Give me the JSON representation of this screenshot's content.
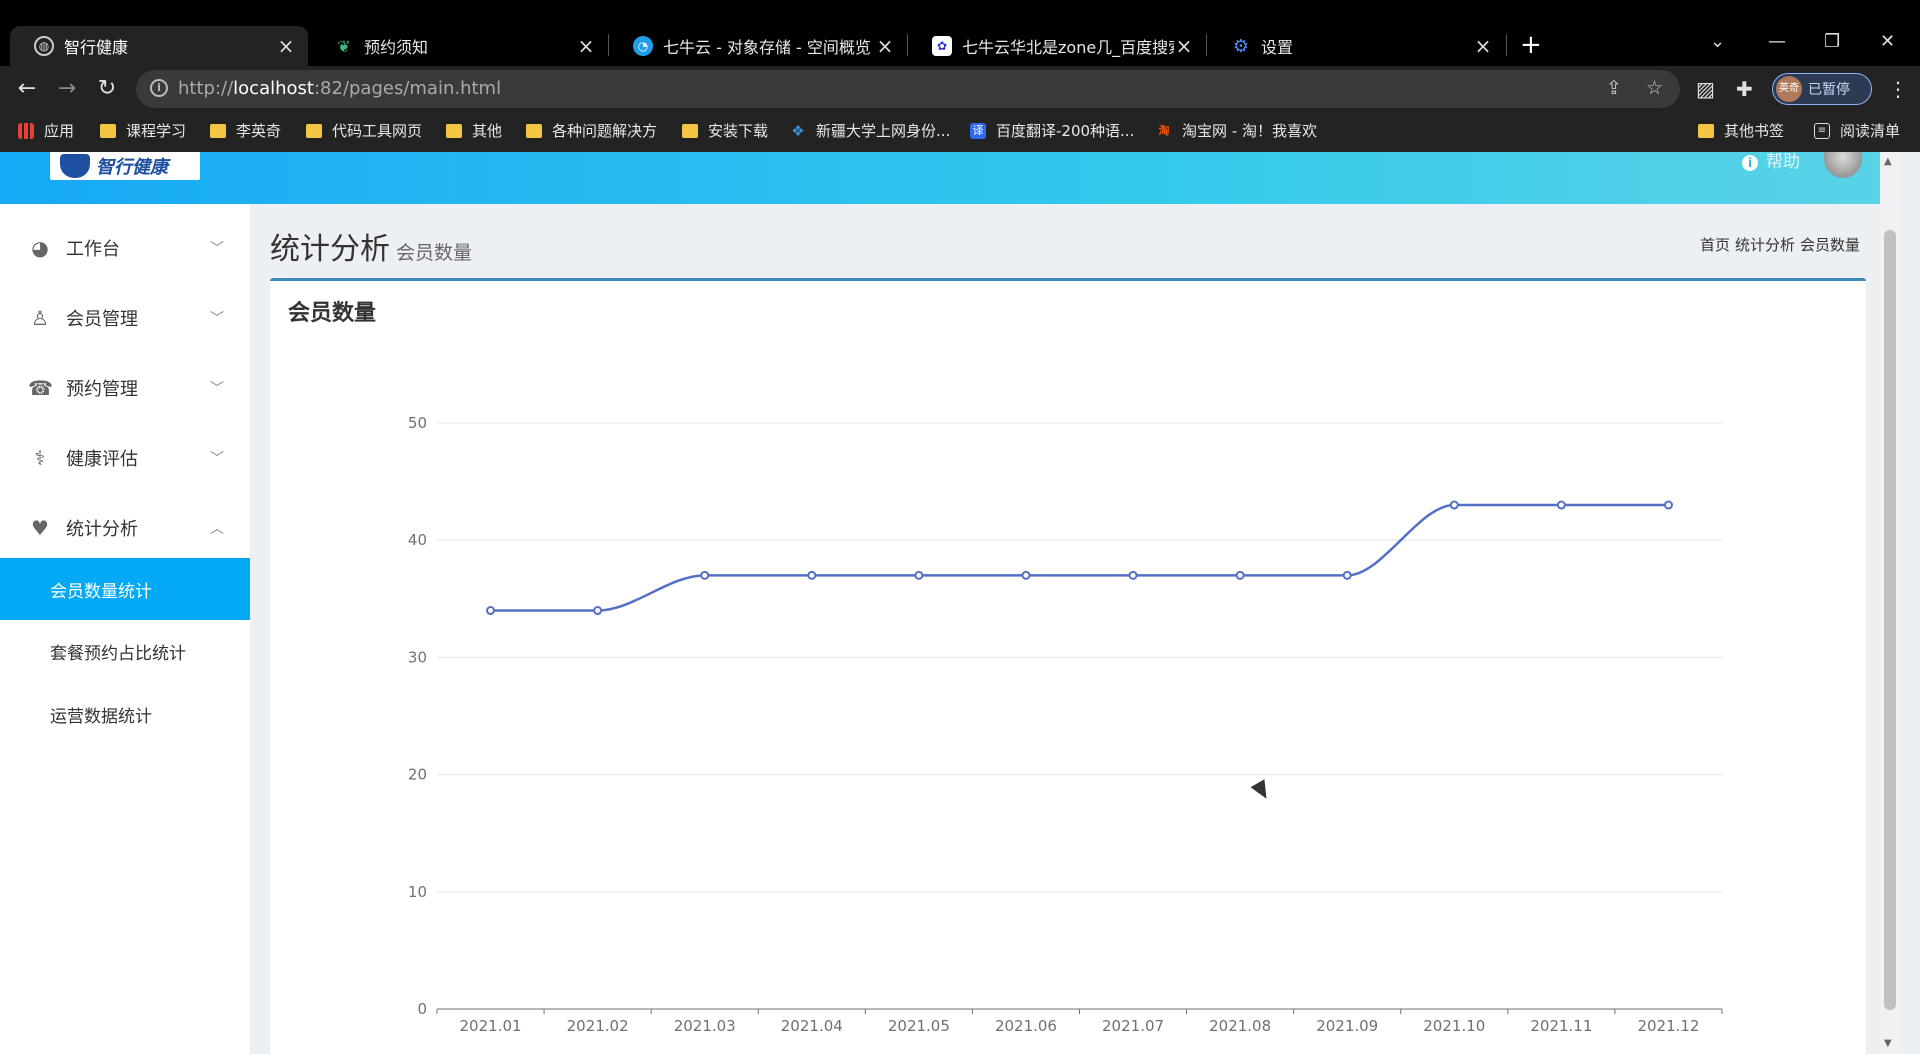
{
  "browser": {
    "tabs": [
      {
        "title": "智行健康",
        "icon": "globe-icon",
        "active": true
      },
      {
        "title": "预约须知",
        "icon": "vue-icon"
      },
      {
        "title": "七牛云 - 对象存储 - 空间概览",
        "icon": "qiniu-icon"
      },
      {
        "title": "七牛云华北是zone几_百度搜索",
        "icon": "baidu-icon"
      },
      {
        "title": "设置",
        "icon": "gear-icon"
      }
    ],
    "url_prefix": "http://",
    "url_host": "localhost",
    "url_rest": ":82/pages/main.html",
    "profile_label": "已暂停",
    "profile_avatar_text": "英奇",
    "bookmarks": [
      {
        "label": "应用",
        "type": "apps"
      },
      {
        "label": "课程学习",
        "type": "folder"
      },
      {
        "label": "李英奇",
        "type": "folder"
      },
      {
        "label": "代码工具网页",
        "type": "folder"
      },
      {
        "label": "其他",
        "type": "folder"
      },
      {
        "label": "各种问题解决方",
        "type": "folder"
      },
      {
        "label": "安装下载",
        "type": "folder"
      },
      {
        "label": "新疆大学上网身份...",
        "type": "site"
      },
      {
        "label": "百度翻译-200种语...",
        "type": "site",
        "glyph": "译"
      },
      {
        "label": "淘宝网 - 淘！我喜欢",
        "type": "site",
        "glyph": "淘"
      },
      {
        "label": "其他书签",
        "type": "folder"
      },
      {
        "label": "阅读清单",
        "type": "list"
      }
    ]
  },
  "header": {
    "logo_text": "智行健康",
    "help_label": "帮助"
  },
  "sidebar": {
    "groups": [
      {
        "label": "工作台",
        "icon": "dashboard-icon",
        "expanded": false
      },
      {
        "label": "会员管理",
        "icon": "user-icon",
        "expanded": false
      },
      {
        "label": "预约管理",
        "icon": "phone-icon",
        "expanded": false
      },
      {
        "label": "健康评估",
        "icon": "stethoscope-icon",
        "expanded": false
      },
      {
        "label": "统计分析",
        "icon": "heartbeat-icon",
        "expanded": true
      }
    ],
    "subitems": [
      {
        "label": "会员数量统计",
        "active": true
      },
      {
        "label": "套餐预约占比统计"
      },
      {
        "label": "运营数据统计"
      }
    ]
  },
  "page": {
    "title": "统计分析",
    "subtitle": "会员数量",
    "breadcrumb": [
      "首页",
      "统计分析",
      "会员数量"
    ],
    "box_title": "会员数量"
  },
  "chart_data": {
    "type": "line",
    "title": "会员数量",
    "smooth": true,
    "color": "#5470c6",
    "x": [
      "2021.01",
      "2021.02",
      "2021.03",
      "2021.04",
      "2021.05",
      "2021.06",
      "2021.07",
      "2021.08",
      "2021.09",
      "2021.10",
      "2021.11",
      "2021.12"
    ],
    "series": [
      {
        "values": [
          34,
          34,
          37,
          37,
          37,
          37,
          37,
          37,
          37,
          43,
          43,
          43
        ]
      }
    ],
    "ylim": [
      0,
      50
    ],
    "yticks": [
      0,
      10,
      20,
      30,
      40,
      50
    ],
    "grid": true
  }
}
